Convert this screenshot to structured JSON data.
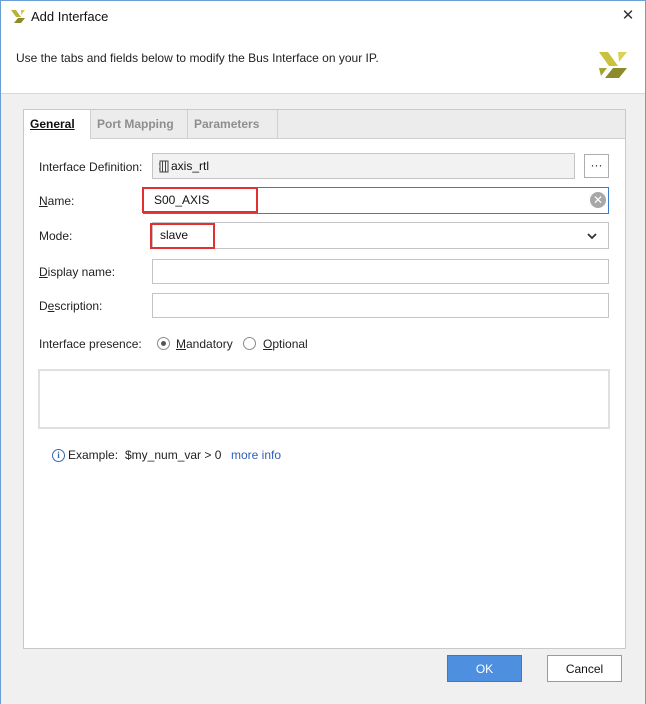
{
  "window": {
    "title": "Add Interface",
    "header_text": "Use the tabs and fields below to modify the Bus Interface on your IP."
  },
  "tabs": [
    {
      "label": "General",
      "active": true
    },
    {
      "label": "Port Mapping",
      "active": false
    },
    {
      "label": "Parameters",
      "active": false
    }
  ],
  "form": {
    "interface_definition": {
      "label": "Interface Definition:",
      "value": "axis_rtl",
      "browse_label": "···"
    },
    "name": {
      "label": "Name:",
      "value": "S00_AXIS"
    },
    "mode": {
      "label": "Mode:",
      "value": "slave"
    },
    "display_name": {
      "label": "Display name:",
      "value": ""
    },
    "description": {
      "label": "Description:",
      "value": ""
    },
    "interface_presence": {
      "label": "Interface presence:",
      "options": [
        "Mandatory",
        "Optional"
      ],
      "selected": "Mandatory"
    },
    "example": {
      "prefix": "Example:",
      "code": "$my_num_var > 0",
      "link": "more info"
    }
  },
  "buttons": {
    "ok": "OK",
    "cancel": "Cancel"
  },
  "colors": {
    "accent": "#4f8fe0",
    "highlight_red": "#e03030",
    "logo_yellow": "#b8b23a",
    "link": "#2d5fb8"
  },
  "icons": [
    "xilinx-logo-icon",
    "close-icon",
    "interface-icon",
    "clear-icon",
    "chevron-down-icon",
    "info-icon"
  ]
}
